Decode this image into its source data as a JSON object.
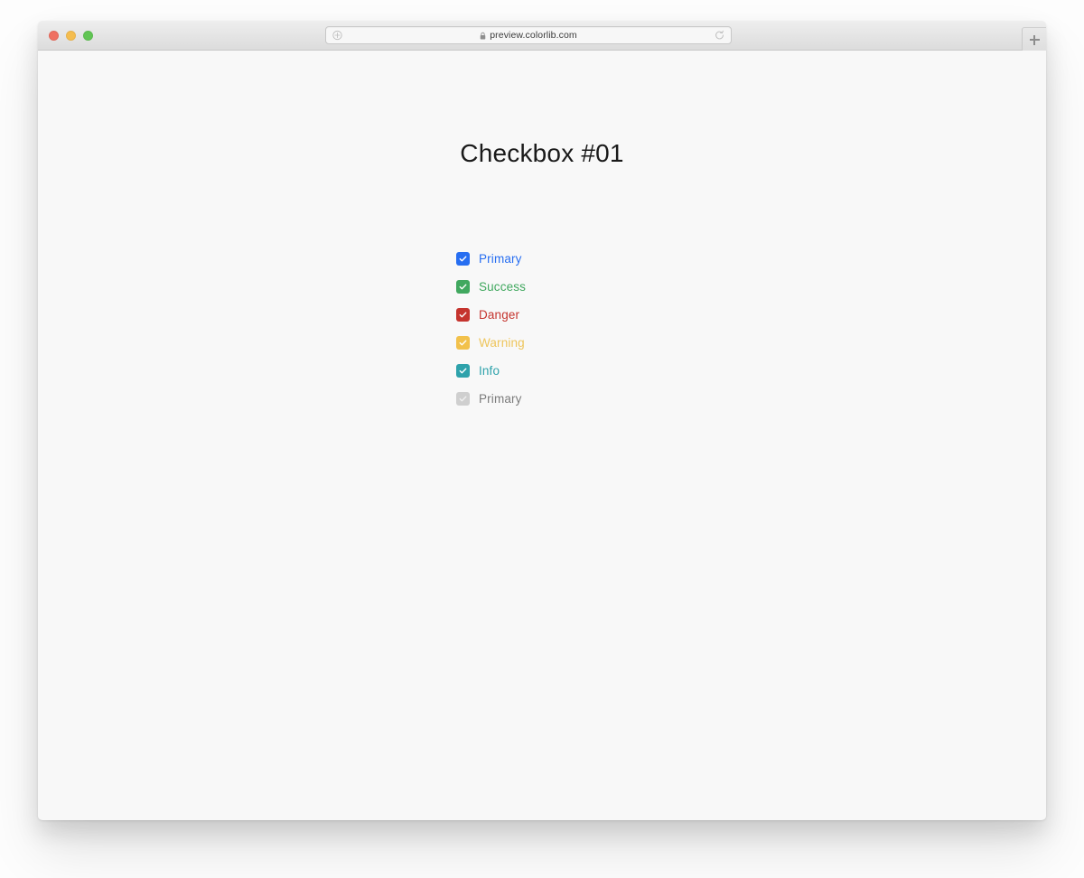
{
  "browser": {
    "traffic_lights": [
      {
        "name": "close",
        "color": "#ef6f61"
      },
      {
        "name": "minimize",
        "color": "#f5bd4f"
      },
      {
        "name": "zoom",
        "color": "#61c554"
      }
    ],
    "address_bar": {
      "url": "preview.colorlib.com",
      "lock_icon": "lock-icon",
      "left_icon": "plus-circle-icon",
      "right_icon": "reload-icon"
    },
    "new_tab": {
      "icon": "plus-icon",
      "label": "+"
    }
  },
  "page": {
    "title": "Checkbox #01",
    "background": "#f8f8f8",
    "checkboxes": [
      {
        "label": "Primary",
        "checked": true,
        "disabled": false,
        "box_color": "#276ef1",
        "text_color": "#276ef1",
        "check_color": "#ffffff"
      },
      {
        "label": "Success",
        "checked": true,
        "disabled": false,
        "box_color": "#41a85f",
        "text_color": "#41a85f",
        "check_color": "#ffffff"
      },
      {
        "label": "Danger",
        "checked": true,
        "disabled": false,
        "box_color": "#c5342e",
        "text_color": "#c5342e",
        "check_color": "#ffffff"
      },
      {
        "label": "Warning",
        "checked": true,
        "disabled": false,
        "box_color": "#f2c14b",
        "text_color": "#eec55b",
        "check_color": "#ffffff"
      },
      {
        "label": "Info",
        "checked": true,
        "disabled": false,
        "box_color": "#2ea2ab",
        "text_color": "#2ea2ab",
        "check_color": "#ffffff"
      },
      {
        "label": "Primary",
        "checked": true,
        "disabled": true,
        "box_color": "#cfcfcf",
        "text_color": "#7b7b7b",
        "check_color": "#f0f0f0"
      }
    ]
  }
}
